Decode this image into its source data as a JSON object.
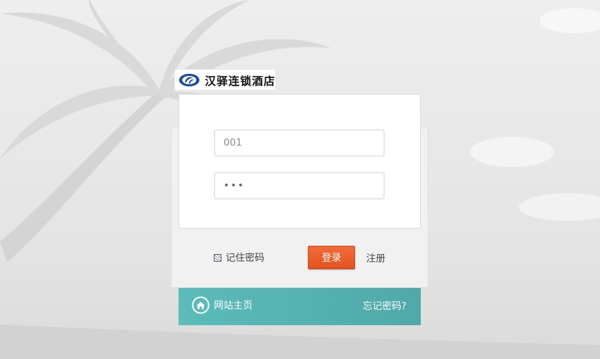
{
  "brand": {
    "name": "汉驿连锁酒店"
  },
  "login_form": {
    "username_value": "001",
    "password_mask": "•••",
    "remember_label": "记住密码",
    "remember_checked": true,
    "submit_label": "登录",
    "register_label": "注册"
  },
  "footer": {
    "home_label": "网站主页",
    "forgot_label": "忘记密码?"
  },
  "icons": {
    "logo": "hotel-logo-mark",
    "home": "home-icon"
  },
  "colors": {
    "primary_button": "#e8582a",
    "footer_bar": "#55b4b2",
    "background": "#e9e9e9"
  }
}
